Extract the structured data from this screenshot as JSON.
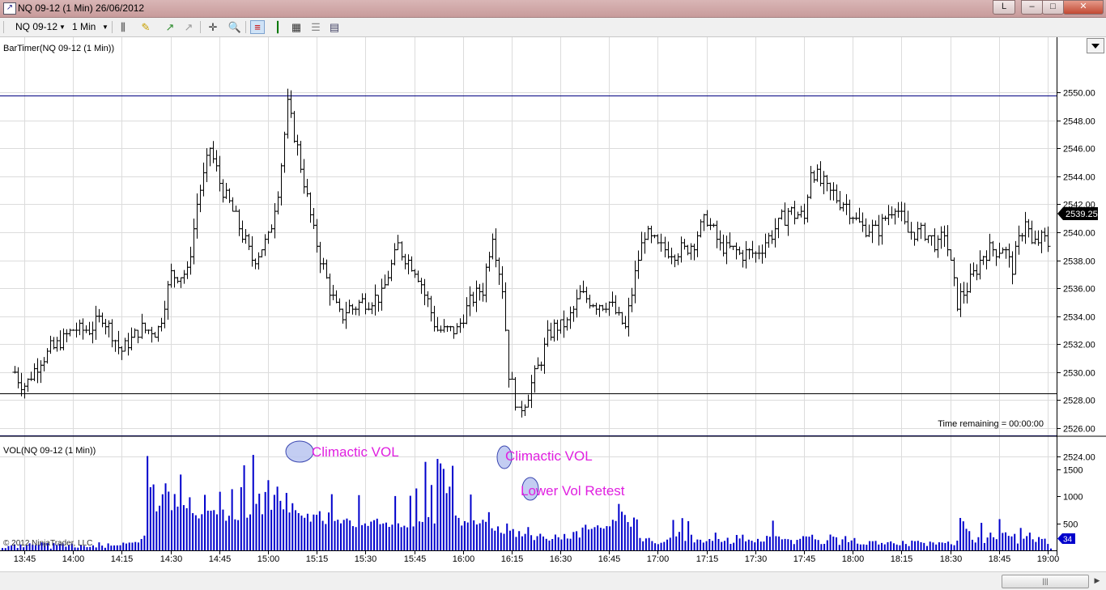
{
  "window": {
    "title": "NQ 09-12 (1 Min)  26/06/2012",
    "buttons": [
      "L",
      "–",
      "□",
      "✕"
    ]
  },
  "toolbar": {
    "instrument": "NQ 09-12",
    "interval": "1 Min",
    "icons": [
      "bar-type-icon",
      "drawing-pencil-icon",
      "add-indicator-icon",
      "remove-indicator-icon",
      "crosshair-icon",
      "zoom-icon",
      "chart-style-bars-icon",
      "chart-style-candles-icon",
      "data-box-icon",
      "properties-icon",
      "panel-icon"
    ]
  },
  "price_panel": {
    "label": "BarTimer(NQ 09-12 (1 Min))",
    "time_remaining": "Time remaining = 00:00:00",
    "current_price": "2539.25",
    "collapse_icon": "dropdown-arrow-icon"
  },
  "volume_panel": {
    "label": "VOL(NQ 09-12 (1 Min))",
    "current_volume": "34",
    "annotations": [
      "Climactic VOL",
      "Climactic VOL",
      "Lower Vol Retest"
    ]
  },
  "copyright": "© 2012 NinjaTrader, LLC",
  "colors": {
    "bars": "#000000",
    "volume": "#0000cc",
    "hline_blue": "#000080",
    "hline_black": "#000000",
    "annotation_text": "#e020e0",
    "annotation_fill": "#b8c4f0"
  },
  "chart_data": [
    {
      "type": "ohlc",
      "y_ticks": [
        "2524.00",
        "2526.00",
        "2528.00",
        "2530.00",
        "2532.00",
        "2534.00",
        "2536.00",
        "2538.00",
        "2540.00",
        "2542.00",
        "2544.00",
        "2546.00",
        "2548.00",
        "2550.00"
      ],
      "ylim": [
        2523.75,
        2550.5
      ],
      "x_ticks": [
        "13:45",
        "14:00",
        "14:15",
        "14:30",
        "14:45",
        "15:00",
        "15:15",
        "15:30",
        "15:45",
        "16:00",
        "16:15",
        "16:30",
        "16:45",
        "17:00",
        "17:15",
        "17:30",
        "17:45",
        "18:00",
        "18:15",
        "18:30",
        "18:45",
        "19:00"
      ],
      "x_start": "13:40",
      "x_end": "19:02",
      "horizontal_lines": [
        2549.75,
        2528.5,
        2525.5
      ],
      "price_path": [
        [
          "13:42",
          2530.0
        ],
        [
          "13:45",
          2529.0
        ],
        [
          "13:50",
          2531.0
        ],
        [
          "13:55",
          2532.0
        ],
        [
          "14:00",
          2533.0
        ],
        [
          "14:05",
          2533.0
        ],
        [
          "14:09",
          2534.0
        ],
        [
          "14:15",
          2531.5
        ],
        [
          "14:20",
          2533.0
        ],
        [
          "14:26",
          2533.0
        ],
        [
          "14:30",
          2537.0
        ],
        [
          "14:35",
          2537.0
        ],
        [
          "14:38",
          2542.0
        ],
        [
          "14:42",
          2546.0
        ],
        [
          "14:45",
          2543.5
        ],
        [
          "14:50",
          2541.0
        ],
        [
          "14:55",
          2538.0
        ],
        [
          "15:00",
          2539.5
        ],
        [
          "15:03",
          2543.0
        ],
        [
          "15:06",
          2549.0
        ],
        [
          "15:09",
          2546.0
        ],
        [
          "15:14",
          2540.0
        ],
        [
          "15:18",
          2536.5
        ],
        [
          "15:22",
          2534.0
        ],
        [
          "15:28",
          2535.0
        ],
        [
          "15:35",
          2535.5
        ],
        [
          "15:40",
          2539.0
        ],
        [
          "15:46",
          2537.0
        ],
        [
          "15:52",
          2533.0
        ],
        [
          "15:58",
          2533.0
        ],
        [
          "16:02",
          2535.0
        ],
        [
          "16:06",
          2536.0
        ],
        [
          "16:09",
          2540.0
        ],
        [
          "16:12",
          2536.0
        ],
        [
          "16:14",
          2530.0
        ],
        [
          "16:17",
          2527.0
        ],
        [
          "16:20",
          2528.5
        ],
        [
          "16:24",
          2531.0
        ],
        [
          "16:27",
          2533.0
        ],
        [
          "16:32",
          2533.5
        ],
        [
          "16:36",
          2535.5
        ],
        [
          "16:40",
          2535.0
        ],
        [
          "16:45",
          2535.0
        ],
        [
          "16:50",
          2533.0
        ],
        [
          "16:53",
          2537.0
        ],
        [
          "16:56",
          2540.0
        ],
        [
          "17:00",
          2539.0
        ],
        [
          "17:05",
          2538.5
        ],
        [
          "17:10",
          2539.0
        ],
        [
          "17:15",
          2541.0
        ],
        [
          "17:19",
          2539.0
        ],
        [
          "17:25",
          2538.5
        ],
        [
          "17:30",
          2538.5
        ],
        [
          "17:35",
          2540.0
        ],
        [
          "17:40",
          2541.5
        ],
        [
          "17:45",
          2541.0
        ],
        [
          "17:47",
          2544.5
        ],
        [
          "17:52",
          2543.0
        ],
        [
          "17:58",
          2542.0
        ],
        [
          "18:02",
          2540.5
        ],
        [
          "18:07",
          2540.0
        ],
        [
          "18:13",
          2542.0
        ],
        [
          "18:17",
          2540.0
        ],
        [
          "18:22",
          2540.0
        ],
        [
          "18:26",
          2539.0
        ],
        [
          "18:28",
          2540.0
        ],
        [
          "18:32",
          2535.0
        ],
        [
          "18:35",
          2536.0
        ],
        [
          "18:40",
          2538.5
        ],
        [
          "18:46",
          2539.0
        ],
        [
          "18:49",
          2537.5
        ],
        [
          "18:53",
          2541.0
        ],
        [
          "18:55",
          2539.0
        ],
        [
          "18:58",
          2539.5
        ],
        [
          "19:00",
          2539.25
        ]
      ]
    },
    {
      "type": "bar",
      "series": [
        {
          "values": [
            43,
            42,
            81,
            92,
            111,
            44,
            109,
            57,
            90,
            130,
            109,
            97,
            106,
            146,
            138,
            131,
            31,
            133,
            101,
            119,
            130,
            68,
            100,
            124,
            54,
            50,
            102,
            84,
            59,
            64,
            92,
            54,
            148,
            88,
            48,
            129,
            88,
            91,
            92,
            94,
            143,
            126,
            144,
            143,
            155,
            145,
            210,
            273,
            1747,
            1170,
            1221,
            722,
            827,
            1039,
            1241,
            1088,
            743,
            1043,
            810,
            1404,
            838,
            781,
            983,
            689,
            650,
            592,
            669,
            1028,
            735,
            734,
            745,
            667,
            1085,
            755,
            548,
            641,
            1133,
            574,
            560,
            1170,
            1576,
            605,
            666,
            1768,
            861,
            1050,
            668,
            1081,
            1300,
            751,
            1028,
            1180,
            917,
            759,
            1064,
            701,
            873,
            743,
            690,
            644,
            603,
            678,
            532,
            663,
            659,
            725,
            547,
            488,
            701,
            1040,
            544,
            568,
            500,
            564,
            589,
            554,
            449,
            431,
            1023,
            467,
            498,
            452,
            532,
            559,
            587,
            485,
            498,
            514,
            434,
            476,
            1006,
            500,
            430,
            456,
            426,
            1011,
            443,
            1147,
            536,
            526,
            1639,
            616,
            1210,
            498,
            1694,
            1610,
            1509,
            1060,
            1180,
            1566,
            645,
            601,
            459,
            541,
            516,
            1034,
            556,
            479,
            501,
            566,
            528,
            707,
            409,
            364,
            444,
            325,
            307,
            497,
            365,
            394,
            249,
            356,
            260,
            305,
            431,
            281,
            191,
            263,
            307,
            256,
            213,
            181,
            210,
            292,
            243,
            202,
            303,
            219,
            215,
            340,
            354,
            237,
            422,
            474,
            386,
            398,
            430,
            463,
            418,
            403,
            449,
            445,
            566,
            544,
            860,
            716,
            656,
            524,
            438,
            607,
            573,
            229,
            167,
            221,
            230,
            172,
            132,
            115,
            140,
            156,
            199,
            234,
            563,
            258,
            341,
            597,
            175,
            541,
            289,
            147,
            201,
            196,
            144,
            170,
            210,
            174,
            328,
            210,
            156,
            175,
            233,
            120,
            141,
            285,
            220,
            290,
            166,
            198,
            178,
            148,
            212,
            162,
            163,
            268,
            252,
            550,
            263,
            257,
            204,
            212,
            207,
            192,
            116,
            194,
            213,
            263,
            258,
            254,
            289,
            204,
            192,
            116,
            120,
            187,
            292,
            255,
            240,
            101,
            204,
            264,
            151,
            183,
            228,
            124,
            109,
            111,
            104,
            171,
            170,
            175,
            108,
            137,
            111,
            150,
            166,
            131,
            107,
            94,
            175,
            118,
            79,
            180,
            170,
            177,
            151,
            137,
            81,
            162,
            146,
            108,
            149,
            145,
            135,
            162,
            113,
            95,
            180,
            600,
            538,
            399,
            356,
            196,
            145,
            244,
            510,
            136,
            238,
            328,
            242,
            207,
            578,
            323,
            333,
            268,
            258,
            305,
            126,
            415,
            216,
            264,
            328,
            205,
            156,
            246,
            211,
            216,
            119,
            34
          ]
        }
      ],
      "y_ticks": [
        "500",
        "1000",
        "1500"
      ],
      "ylim": [
        0,
        2000
      ],
      "x_start": "13:40",
      "x_end": "19:02"
    }
  ]
}
